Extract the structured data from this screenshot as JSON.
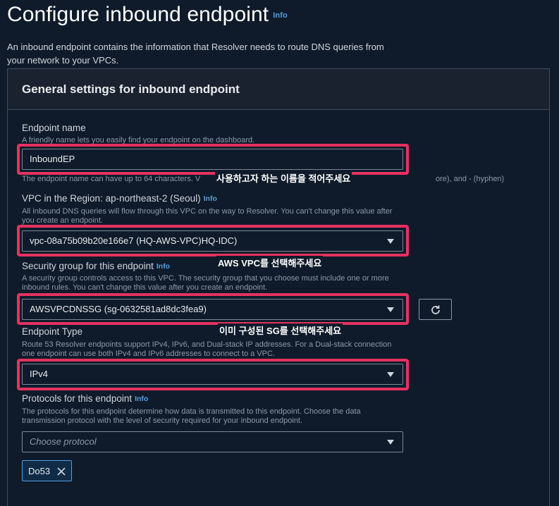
{
  "page": {
    "title": "Configure inbound endpoint",
    "info": "Info",
    "description": "An inbound endpoint contains the information that Resolver needs to route DNS queries from your network to your VPCs."
  },
  "panel": {
    "title": "General settings for inbound endpoint"
  },
  "endpoint_name": {
    "label": "Endpoint name",
    "description": "A friendly name lets you easily find your endpoint on the dashboard.",
    "value": "InboundEP",
    "hint_start": "The endpoint name can have up to 64 characters. V",
    "hint_end": "ore), and - (hyphen)"
  },
  "vpc": {
    "label": "VPC in the Region: ap-northeast-2 (Seoul)",
    "info": "Info",
    "description": "All inbound DNS queries will flow through this VPC on the way to Resolver. You can't change this value after you create an endpoint.",
    "value": "vpc-08a75b09b20e166e7 (HQ-AWS-VPC)HQ-IDC)"
  },
  "security_group": {
    "label": "Security group for this endpoint",
    "info": "Info",
    "description": "A security group controls access to this VPC. The security group that you choose must include one or more inbound rules. You can't change this value after you create an endpoint.",
    "value": "AWSVPCDNSSG (sg-0632581ad8dc3fea9)"
  },
  "endpoint_type": {
    "label": "Endpoint Type",
    "description": "Route 53 Resolver endpoints support IPv4, IPv6, and Dual-stack IP addresses. For a Dual-stack connection one endpoint can use both IPv4 and IPv6 addresses to connect to a VPC.",
    "value": "IPv4"
  },
  "protocols": {
    "label": "Protocols for this endpoint",
    "info": "Info",
    "description": "The protocols for this endpoint determine how data is transmitted to this endpoint. Choose the data transmission protocol with the level of security required for your inbound endpoint.",
    "placeholder": "Choose protocol",
    "selected_token": "Do53"
  },
  "annotations": {
    "name_note": "사용하고자 하는 이름을 적어주세요",
    "vpc_note": "AWS VPC를 선택해주세요",
    "sg_note": "이미 구성된 SG를 선택해주세요"
  },
  "colors": {
    "highlight": "#e6325f",
    "link": "#539fe5"
  },
  "icons": {
    "refresh": "refresh-icon",
    "caret": "caret-down-icon",
    "dismiss": "close-icon"
  }
}
